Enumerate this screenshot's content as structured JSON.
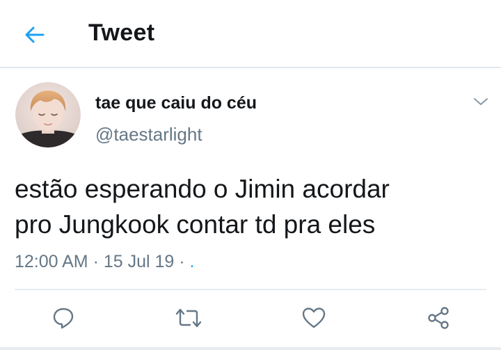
{
  "header": {
    "title": "Tweet"
  },
  "tweet": {
    "display_name": "tae que caiu do céu",
    "handle": "@taestarlight",
    "text": "estão esperando o Jimin acordar\npro Jungkook contar td pra eles",
    "time": "12:00 AM",
    "separator": " · ",
    "date": "15 Jul 19",
    "source": "."
  },
  "icons": {
    "back": "arrow-left-icon",
    "menu": "chevron-down-icon",
    "reply": "reply-icon",
    "retweet": "retweet-icon",
    "like": "heart-icon",
    "share": "share-icon"
  },
  "colors": {
    "accent": "#1da1f2",
    "text": "#14171a",
    "secondary": "#657786",
    "icon": "#657786",
    "divider": "#e1e8ed"
  }
}
